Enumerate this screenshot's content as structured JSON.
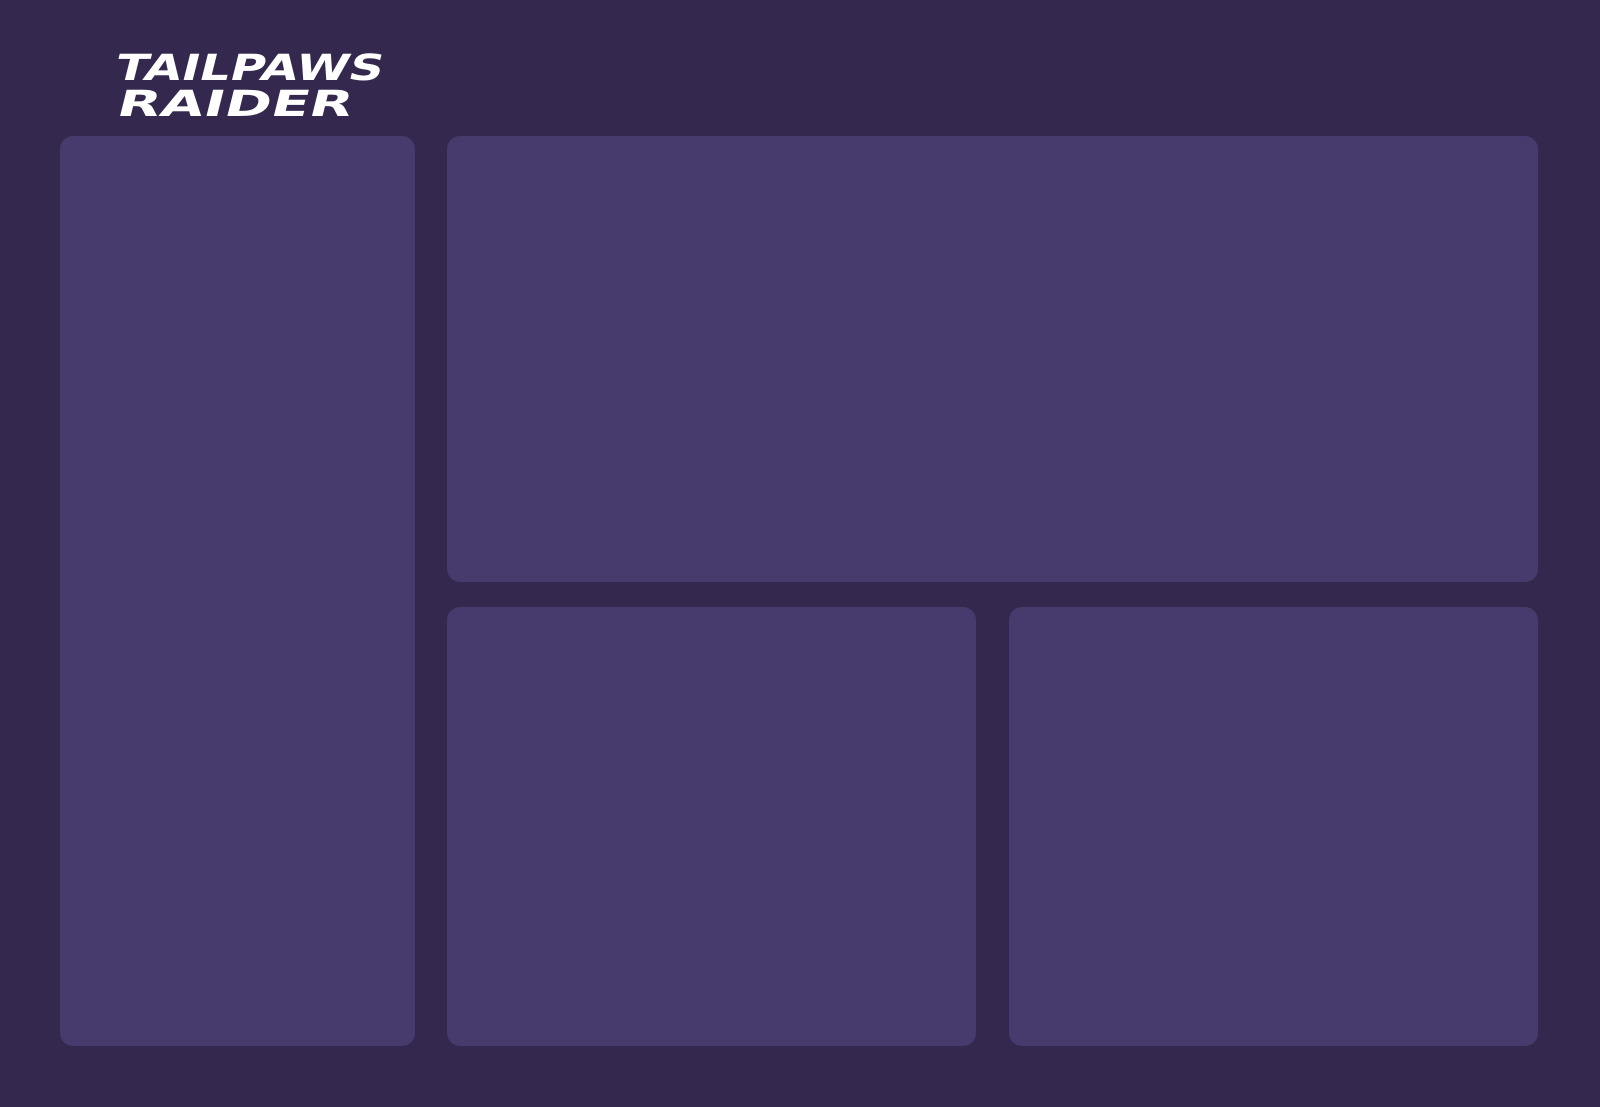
{
  "brand": {
    "logo_line1": "TAILPAWS",
    "logo_line2": "RAIDER"
  },
  "theme": {
    "background": "#34284f",
    "panel": "#473a6c",
    "logo": "#ffffff"
  },
  "panels": [
    {
      "id": "panel-left"
    },
    {
      "id": "panel-top"
    },
    {
      "id": "panel-bottom-left"
    },
    {
      "id": "panel-bottom-right"
    }
  ]
}
